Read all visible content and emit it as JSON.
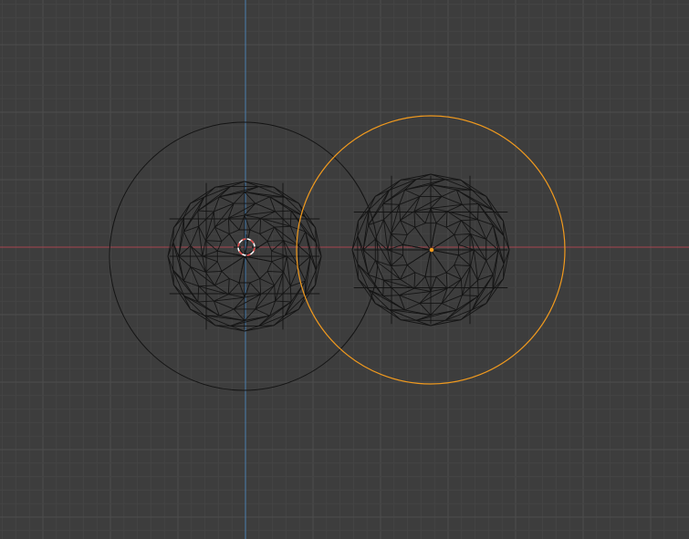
{
  "viewport": {
    "view": "top-orthographic",
    "shading": "wireframe"
  },
  "colors": {
    "background": "#3d3d3d",
    "grid_minor": "#444444",
    "grid_major": "#4d4d4d",
    "axis_x": "#a8454f",
    "axis_y": "#4a7fb0",
    "wire": "#141414",
    "selected": "#f19a1e",
    "object_origin": "#f19a1e",
    "cursor_red": "#e04a4a",
    "cursor_white": "#ffffff"
  },
  "objects": [
    {
      "id": "sphere-left",
      "selected": false,
      "has_influence_circle": true
    },
    {
      "id": "sphere-right",
      "selected": true,
      "has_influence_circle": true
    }
  ],
  "icons": {
    "cursor": "3d-cursor-icon",
    "origin": "object-origin-icon"
  }
}
